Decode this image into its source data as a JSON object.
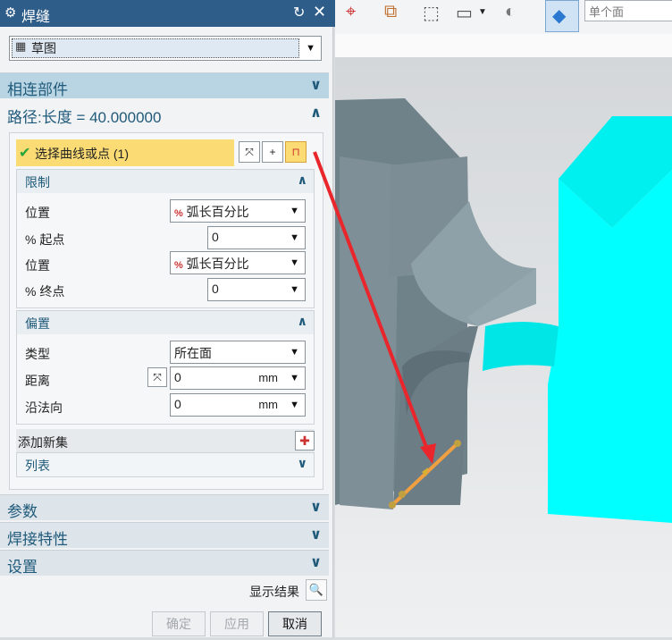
{
  "dialog": {
    "title": "焊缝",
    "type_value": "草图",
    "sections": {
      "connected_parts": "相连部件",
      "path": "路径:长度 = 40.000000",
      "params": "参数",
      "weld_props": "焊接特性",
      "settings": "设置"
    },
    "select_curve": "选择曲线或点 (1)",
    "limits": {
      "header": "限制",
      "pos1_label": "位置",
      "pos1_value": "弧长百分比",
      "start_label": "% 起点",
      "start_value": "0",
      "pos2_label": "位置",
      "pos2_value": "弧长百分比",
      "end_label": "% 终点",
      "end_value": "0"
    },
    "offset": {
      "header": "偏置",
      "type_label": "类型",
      "type_value": "所在面",
      "dist_label": "距离",
      "dist_value": "0",
      "dist_unit": "mm",
      "normal_label": "沿法向",
      "normal_value": "0",
      "normal_unit": "mm"
    },
    "add_new_set": "添加新集",
    "list": "列表",
    "show_result": "显示结果",
    "buttons": {
      "ok": "确定",
      "apply": "应用",
      "cancel": "取消"
    }
  },
  "toolbar": {
    "filter_text": "单个面"
  },
  "colors": {
    "title_bg": "#2f5d8a",
    "section_blue": "#b9d5e4",
    "select_highlight": "#fbdc74",
    "part_cyan": "#00ffff",
    "part_gray": "#7f8f96",
    "arrow_red": "#e8262b",
    "weld_orange": "#f0a040"
  }
}
